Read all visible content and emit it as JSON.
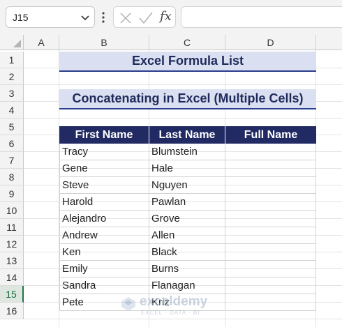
{
  "formula_bar": {
    "name_box": "J15",
    "fx_label": "fx",
    "formula": ""
  },
  "columns": [
    "A",
    "B",
    "C",
    "D"
  ],
  "rows": [
    "1",
    "2",
    "3",
    "4",
    "5",
    "6",
    "7",
    "8",
    "9",
    "10",
    "11",
    "12",
    "13",
    "14",
    "15",
    "16"
  ],
  "active_row": "15",
  "sheet": {
    "title": "Excel Formula List",
    "subtitle": "Concatenating in Excel (Multiple Cells)",
    "headers": [
      "First Name",
      "Last Name",
      "Full Name"
    ],
    "data": [
      [
        "Tracy",
        "Blumstein",
        ""
      ],
      [
        "Gene",
        "Hale",
        ""
      ],
      [
        "Steve",
        "Nguyen",
        ""
      ],
      [
        "Harold",
        "Pawlan",
        ""
      ],
      [
        "Alejandro",
        "Grove",
        ""
      ],
      [
        "Andrew",
        "Allen",
        ""
      ],
      [
        "Ken",
        "Black",
        ""
      ],
      [
        "Emily",
        "Burns",
        ""
      ],
      [
        "Sandra",
        "Flanagan",
        ""
      ],
      [
        "Pete",
        "Kriz",
        ""
      ]
    ]
  },
  "watermark": {
    "name": "exceldemy",
    "tagline": "EXCEL · DATA · BI"
  },
  "colors": {
    "title_fill": "#dae0f1",
    "header_fill": "#212a63",
    "accent_green": "#217346"
  }
}
